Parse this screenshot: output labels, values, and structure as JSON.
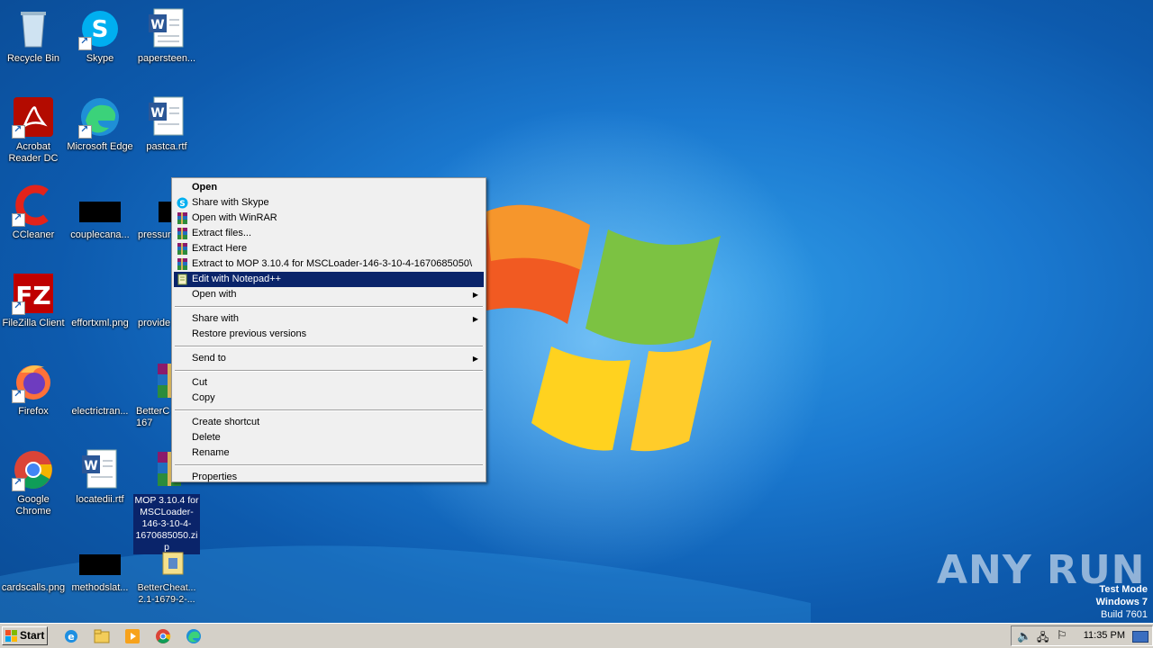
{
  "desktop": {
    "icons": [
      {
        "label": "Recycle Bin",
        "icon": "recycle-bin-icon"
      },
      {
        "label": "Skype",
        "icon": "skype-icon"
      },
      {
        "label": "papersteen...",
        "icon": "word-doc-icon"
      },
      {
        "label": "Acrobat Reader DC",
        "icon": "acrobat-icon"
      },
      {
        "label": "Microsoft Edge",
        "icon": "edge-icon"
      },
      {
        "label": "pastca.rtf",
        "icon": "word-doc-icon"
      },
      {
        "label": "CCleaner",
        "icon": "ccleaner-icon"
      },
      {
        "label": "couplecana...",
        "icon": "black-thumb-icon"
      },
      {
        "label": "pressur",
        "icon": "black-thumb-icon"
      },
      {
        "label": "FileZilla Client",
        "icon": "filezilla-icon"
      },
      {
        "label": "effortxml.png",
        "icon": "blank-thumb-icon"
      },
      {
        "label": "provide",
        "icon": "blank-thumb-icon"
      },
      {
        "label": "Firefox",
        "icon": "firefox-icon"
      },
      {
        "label": "electrictran...",
        "icon": "blank-thumb-icon"
      },
      {
        "label": "BetterC 2.1-167",
        "icon": "winrar-icon"
      },
      {
        "label": "Google Chrome",
        "icon": "chrome-icon"
      },
      {
        "label": "locatedii.rtf",
        "icon": "word-doc-icon"
      },
      {
        "label": "MOP 3.10.4 for MSCLoader-146-3-10-4-1670685050.zip",
        "icon": "winrar-icon"
      },
      {
        "label": "cardscalls.png",
        "icon": "blank-thumb-icon"
      },
      {
        "label": "methodslat...",
        "icon": "black-thumb-icon"
      },
      {
        "label": "BetterCheat... 2.1-1679-2-...",
        "icon": "installer-icon"
      }
    ]
  },
  "context_menu": {
    "items": [
      {
        "label": "Open",
        "bold": true
      },
      {
        "label": "Share with Skype",
        "icon": "skype-icon"
      },
      {
        "label": "Open with WinRAR",
        "icon": "winrar-icon"
      },
      {
        "label": "Extract files...",
        "icon": "winrar-icon"
      },
      {
        "label": "Extract Here",
        "icon": "winrar-icon"
      },
      {
        "label": "Extract to MOP 3.10.4 for MSCLoader-146-3-10-4-1670685050\\",
        "icon": "winrar-icon"
      },
      {
        "label": "Edit with Notepad++",
        "icon": "notepadpp-icon",
        "highlighted": true
      },
      {
        "label": "Open with",
        "submenu": true
      },
      {
        "label": "Share with",
        "submenu": true
      },
      {
        "label": "Restore previous versions"
      },
      {
        "label": "Send to",
        "submenu": true
      },
      {
        "label": "Cut"
      },
      {
        "label": "Copy"
      },
      {
        "label": "Create shortcut"
      },
      {
        "label": "Delete"
      },
      {
        "label": "Rename"
      },
      {
        "label": "Properties"
      }
    ]
  },
  "taskbar": {
    "start_label": "Start",
    "clock": "11:35 PM",
    "quick_launch": [
      "ie-icon",
      "explorer-icon",
      "media-player-icon",
      "chrome-icon",
      "edge-icon"
    ]
  },
  "watermark": {
    "line1": "Test Mode",
    "line2": "Windows 7",
    "line3": "Build 7601",
    "brand": "ANY RUN"
  },
  "colors": {
    "selection": "#0a246a",
    "menu_bg": "#f0f0f0",
    "taskbar_bg": "#d4d0c8"
  }
}
